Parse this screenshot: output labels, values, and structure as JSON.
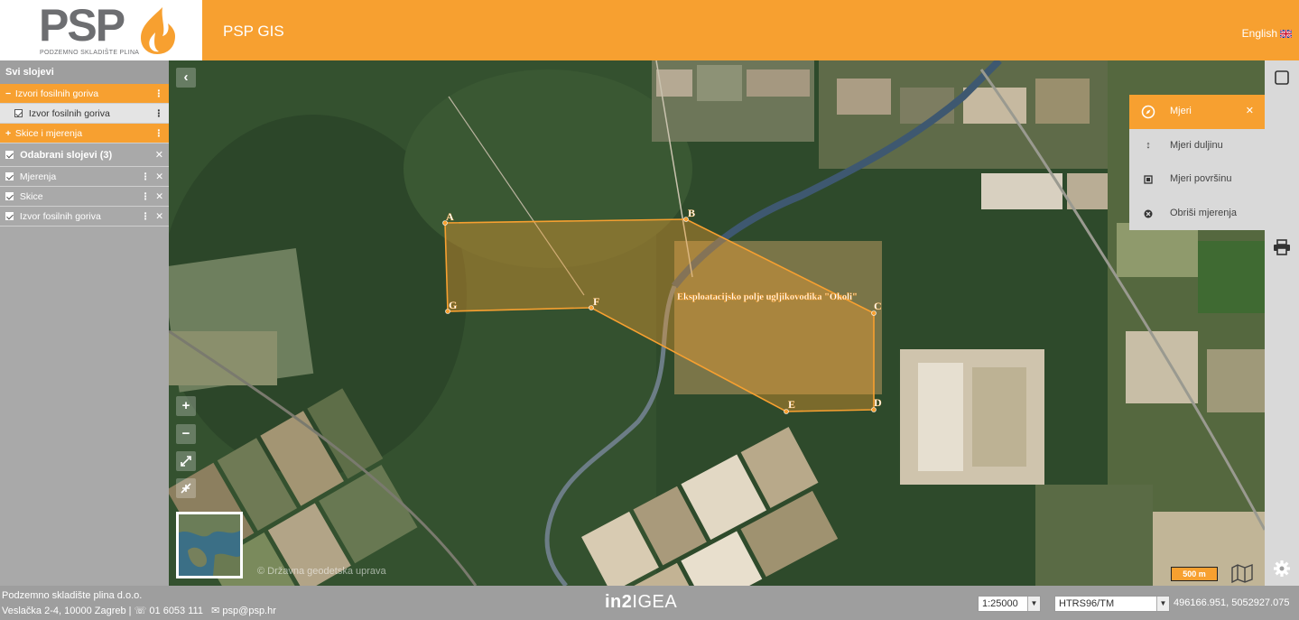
{
  "header": {
    "logo_text": "PSP",
    "logo_subtitle": "PODZEMNO SKLADIŠTE PLINA",
    "app_title": "PSP GIS",
    "language": "English",
    "accent_color": "#f7a030"
  },
  "layers_panel": {
    "all_layers_title": "Svi slojevi",
    "groups": [
      {
        "label": "Izvori fosilnih goriva",
        "expanded": true,
        "children": [
          "Izvor fosilnih goriva"
        ]
      },
      {
        "label": "Skice i mjerenja",
        "expanded": false
      }
    ],
    "selected_title": "Odabrani slojevi (3)",
    "selected_layers": [
      "Mjerenja",
      "Skice",
      "Izvor fosilnih goriva"
    ]
  },
  "map": {
    "polygon_points": [
      "A",
      "B",
      "C",
      "D",
      "E",
      "F",
      "G"
    ],
    "polygon_label": "Eksploatacijsko polje ugljikovodika \"Okoli\"",
    "attribution": "© Državna geodetska uprava",
    "scale_label": "500 m",
    "controls": {
      "collapse": "‹",
      "zoom_in": "+",
      "zoom_out": "−"
    }
  },
  "measure_menu": {
    "title": "Mjeri",
    "items": [
      "Mjeri duljinu",
      "Mjeri površinu",
      "Obriši mjerenja"
    ]
  },
  "footer": {
    "company": "Podzemno skladište plina d.o.o.",
    "address": "Veslačka 2-4, 10000 Zagreb",
    "phone": "01 6053 111",
    "email": "psp@psp.hr",
    "brand_bold": "in2",
    "brand_light": "IGEA",
    "scale_select": "1:25000",
    "projection_select": "HTRS96/TM",
    "coordinates": "496166.951, 5052927.075"
  }
}
